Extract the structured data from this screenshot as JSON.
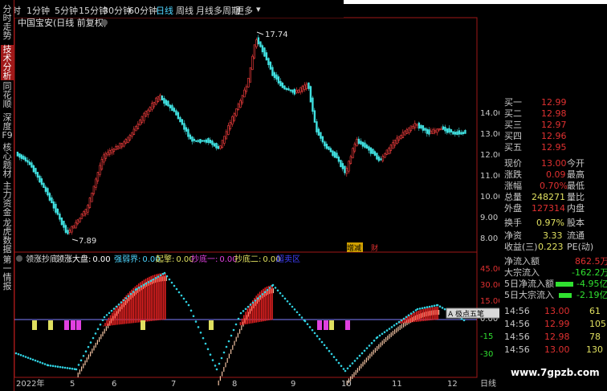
{
  "toolbar": {
    "items": [
      "分时",
      "1分钟",
      "5分钟",
      "15分钟",
      "30分钟",
      "60分钟",
      "日线",
      "周线",
      "月线",
      "多周期",
      "更多"
    ],
    "active": "日线"
  },
  "sidebar": {
    "tabs": [
      "分时走势",
      "技术分析",
      "同花顺",
      "深度F9",
      "核心题材",
      "主力资金",
      "龙虎数据",
      "第一情报"
    ],
    "active": "技术分析"
  },
  "main_chart": {
    "title": "中国宝安(日线 前复权)",
    "high_label": "17.74",
    "low_label": "7.89",
    "yticks": [
      "14.00",
      "13.00",
      "12.00",
      "11.00",
      "10.00",
      "9.00",
      "8.00"
    ],
    "events": [
      "增减",
      "财"
    ]
  },
  "indicator": {
    "title": "领涨抄底",
    "items": [
      {
        "label": "领涨大盘:",
        "value": "0.00",
        "color": "#ffffff"
      },
      {
        "label": "强弱界:",
        "value": "0.00",
        "color": "#4fd6ff"
      },
      {
        "label": "起擎:",
        "value": "0.00",
        "color": "#e0e060"
      },
      {
        "label": "抄底一:",
        "value": "0.00",
        "color": "#e040e0"
      },
      {
        "label": "抄底二:",
        "value": "0.00",
        "color": "#e0e060"
      },
      {
        "label": "超卖区",
        "value": "",
        "color": "#4040ff"
      }
    ],
    "yticks": [
      "45.00",
      "30.00",
      "15.00",
      "0.00",
      "-15",
      "-30"
    ],
    "button_label": "A 极点五笔",
    "dates": [
      "2022年",
      "5",
      "6",
      "7",
      "8",
      "9",
      "10",
      "11",
      "12"
    ],
    "corner_label": "日线"
  },
  "quote": {
    "bids": [
      {
        "label": "买一",
        "value": "12.99"
      },
      {
        "label": "买二",
        "value": "12.98"
      },
      {
        "label": "买三",
        "value": "12.97"
      },
      {
        "label": "买四",
        "value": "12.96"
      },
      {
        "label": "买五",
        "value": "12.95"
      }
    ],
    "stats": [
      {
        "label": "现价",
        "value": "13.00",
        "label2": "今开",
        "color": "#e03030"
      },
      {
        "label": "涨跌",
        "value": "0.09",
        "label2": "最高",
        "color": "#e03030"
      },
      {
        "label": "涨幅",
        "value": "0.70%",
        "label2": "最低",
        "color": "#e03030"
      },
      {
        "label": "总量",
        "value": "248271",
        "label2": "量比",
        "color": "#e0e060"
      },
      {
        "label": "外盘",
        "value": "127314",
        "label2": "内盘",
        "color": "#e03030"
      },
      {
        "label": "换手",
        "value": "0.97%",
        "label2": "股本",
        "color": "#e0e060"
      },
      {
        "label": "净资",
        "value": "3.33",
        "label2": "流通",
        "color": "#e0e060"
      },
      {
        "label": "收益(三)",
        "value": "0.223",
        "label2": "PE(动)",
        "color": "#e0e060"
      }
    ],
    "flows": [
      {
        "label": "净流入额",
        "value": "862.5万",
        "color": "#e03030"
      },
      {
        "label": "大宗流入",
        "value": "-162.2万",
        "color": "#30e030"
      },
      {
        "label": "5日净流入额",
        "value": "-4.95亿",
        "color": "#30e030"
      },
      {
        "label": "5日大宗流入",
        "value": "-2.19亿",
        "color": "#30e030"
      }
    ],
    "ticks": [
      {
        "time": "14:56",
        "price": "13.00",
        "vol": "61",
        "color": "#e03030"
      },
      {
        "time": "14:56",
        "price": "12.99",
        "vol": "105",
        "color": "#e03030"
      },
      {
        "time": "14:56",
        "price": "12.98",
        "vol": "78",
        "color": "#e03030"
      },
      {
        "time": "14:56",
        "price": "13.00",
        "vol": "130",
        "color": "#e03030"
      }
    ]
  },
  "watermark": "www.7gpzb.com"
}
